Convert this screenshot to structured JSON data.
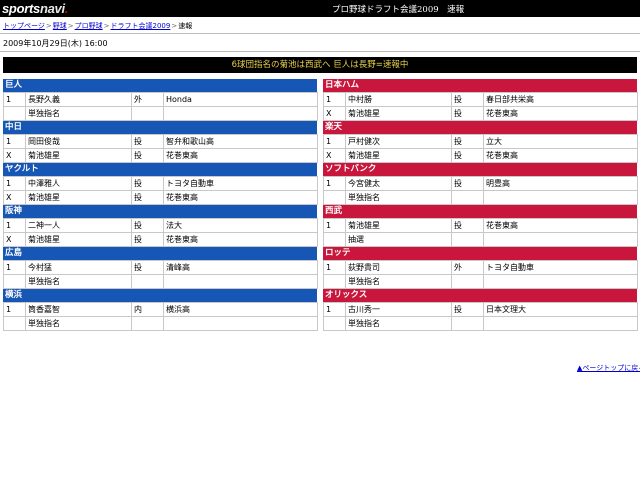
{
  "header": {
    "logo_main": "sports",
    "logo_navi": "navi",
    "title": "プロ野球ドラフト会議2009　速報"
  },
  "breadcrumb": {
    "items": [
      "トップページ",
      "野球",
      "プロ野球",
      "ドラフト会議2009"
    ],
    "current": "速報",
    "separator": ">"
  },
  "datetime": "2009年10月29日(木) 16:00",
  "headline": "6球団指名の菊池は西武へ 巨人は長野=速報中",
  "left_teams": [
    {
      "name": "巨人",
      "rows": [
        [
          "1",
          "長野久義",
          "外",
          "Honda"
        ],
        [
          "",
          "単独指名",
          "",
          ""
        ]
      ]
    },
    {
      "name": "中日",
      "rows": [
        [
          "1",
          "岡田俊哉",
          "投",
          "智弁和歌山高"
        ],
        [
          "X",
          "菊池雄星",
          "投",
          "花巻東高"
        ]
      ]
    },
    {
      "name": "ヤクルト",
      "rows": [
        [
          "1",
          "中澤雅人",
          "投",
          "トヨタ自動車"
        ],
        [
          "X",
          "菊池雄星",
          "投",
          "花巻東高"
        ]
      ]
    },
    {
      "name": "阪神",
      "rows": [
        [
          "1",
          "二神一人",
          "投",
          "法大"
        ],
        [
          "X",
          "菊池雄星",
          "投",
          "花巻東高"
        ]
      ]
    },
    {
      "name": "広島",
      "rows": [
        [
          "1",
          "今村猛",
          "投",
          "清峰高"
        ],
        [
          "",
          "単独指名",
          "",
          ""
        ]
      ]
    },
    {
      "name": "横浜",
      "rows": [
        [
          "1",
          "筒香嘉智",
          "内",
          "横浜高"
        ],
        [
          "",
          "単独指名",
          "",
          ""
        ]
      ]
    }
  ],
  "right_teams": [
    {
      "name": "日本ハム",
      "rows": [
        [
          "1",
          "中村勝",
          "投",
          "春日部共栄高"
        ],
        [
          "X",
          "菊池雄星",
          "投",
          "花巻東高"
        ]
      ]
    },
    {
      "name": "楽天",
      "rows": [
        [
          "1",
          "戸村健次",
          "投",
          "立大"
        ],
        [
          "X",
          "菊池雄星",
          "投",
          "花巻東高"
        ]
      ]
    },
    {
      "name": "ソフトバンク",
      "rows": [
        [
          "1",
          "今宮健太",
          "投",
          "明豊高"
        ],
        [
          "",
          "単独指名",
          "",
          ""
        ]
      ]
    },
    {
      "name": "西武",
      "rows": [
        [
          "1",
          "菊池雄星",
          "投",
          "花巻東高"
        ],
        [
          "",
          "抽選",
          "",
          ""
        ]
      ]
    },
    {
      "name": "ロッテ",
      "rows": [
        [
          "1",
          "荻野貴司",
          "外",
          "トヨタ自動車"
        ],
        [
          "",
          "単独指名",
          "",
          ""
        ]
      ]
    },
    {
      "name": "オリックス",
      "rows": [
        [
          "1",
          "古川秀一",
          "投",
          "日本文理大"
        ],
        [
          "",
          "単独指名",
          "",
          ""
        ]
      ]
    }
  ],
  "footer": {
    "page_top": "▲ページトップに戻る"
  }
}
